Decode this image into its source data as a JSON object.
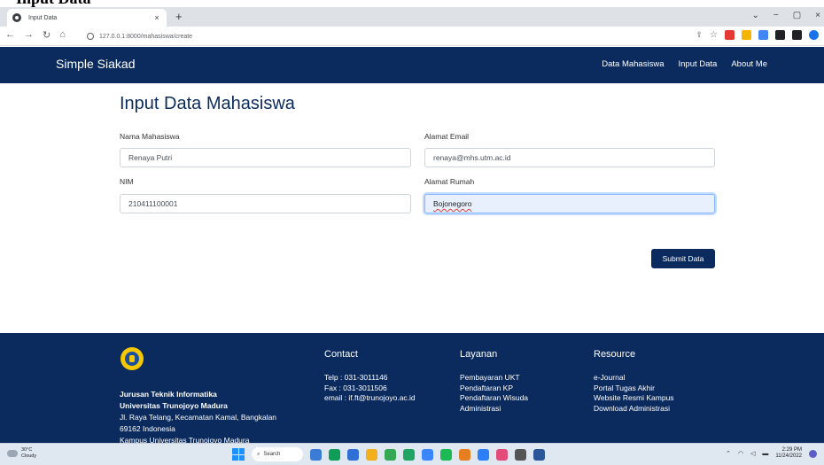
{
  "caption": "Input Data",
  "browser": {
    "tab_title": "Input Data",
    "tab_close": "×",
    "new_tab": "+",
    "url": "127.0.0.1:8000/mahasiswa/create",
    "window_controls": [
      "⌄",
      "−",
      "▢",
      "×"
    ]
  },
  "navbar": {
    "brand": "Simple Siakad",
    "links": [
      "Data Mahasiswa",
      "Input Data",
      "About Me"
    ]
  },
  "form": {
    "title": "Input Data Mahasiswa",
    "fields": {
      "nama": {
        "label": "Nama Mahasiswa",
        "value": "Renaya Putri"
      },
      "email": {
        "label": "Alamat Email",
        "value": "renaya@mhs.utm.ac.id"
      },
      "nim": {
        "label": "NIM",
        "value": "210411100001"
      },
      "alamat": {
        "label": "Alamat Rumah",
        "value": "Bojonegoro"
      }
    },
    "submit_label": "Submit Data"
  },
  "footer": {
    "org_lines": [
      {
        "text": "Jurusan Teknik Informatika",
        "bold": true
      },
      {
        "text": "Universitas Trunojoyo Madura",
        "bold": true
      },
      {
        "text": "Jl. Raya Telang, Kecamatan Kamal, Bangkalan",
        "bold": false
      },
      {
        "text": "69162 Indonesia",
        "bold": false
      },
      {
        "text": "Kampus Universitas Trunojoyo Madura",
        "bold": false
      }
    ],
    "contact": {
      "heading": "Contact",
      "lines": [
        "Telp : 031-3011146",
        "Fax : 031-3011506",
        "email : if.ft@trunojoyo.ac.id"
      ]
    },
    "layanan": {
      "heading": "Layanan",
      "lines": [
        "Pembayaran UKT",
        "Pendaftaran KP",
        "Pendaftaran Wisuda",
        "Administrasi"
      ]
    },
    "resource": {
      "heading": "Resource",
      "lines": [
        "e-Journal",
        "Portal Tugas Akhir",
        "Website Resmi Kampus",
        "Download Administrasi"
      ]
    }
  },
  "taskbar": {
    "weather_temp": "30°C",
    "weather_desc": "Cloudy",
    "search_label": "Search",
    "time": "2:29 PM",
    "date": "11/24/2022",
    "app_colors": [
      "#3a7bd5",
      "#0f9d58",
      "#2f6fd6",
      "#f2b01e",
      "#34a853",
      "#1fa463",
      "#3a86ff",
      "#1db954",
      "#e67e22",
      "#2d7ff9",
      "#e34c7a",
      "#555555",
      "#2b579a"
    ]
  },
  "extensions": {
    "colors": [
      "#e53935",
      "#f4b400",
      "#4285f4",
      "#202124",
      "#202124",
      "#1a73e8"
    ]
  }
}
